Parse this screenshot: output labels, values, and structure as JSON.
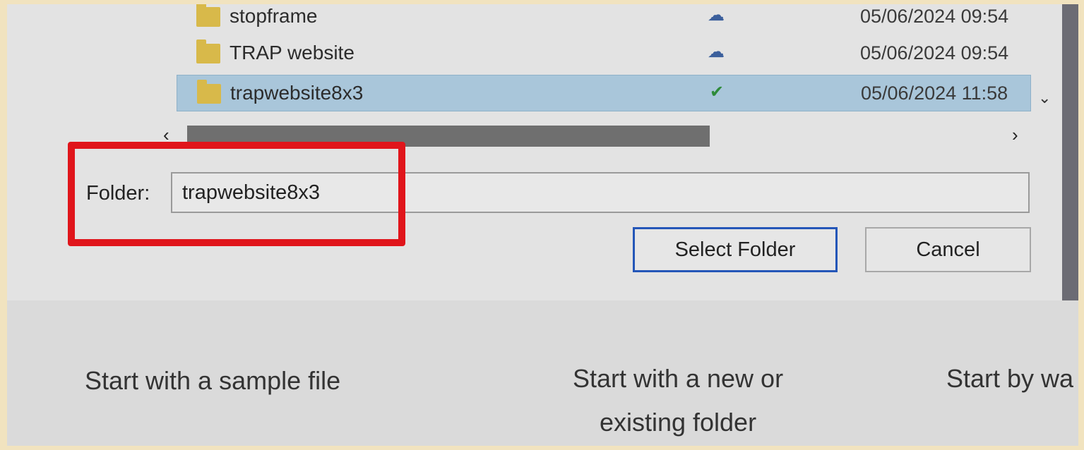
{
  "file_list": {
    "rows": [
      {
        "name": "stopframe",
        "status_icon": "cloud-icon",
        "date": "05/06/2024 09:54"
      },
      {
        "name": "TRAP website",
        "status_icon": "cloud-icon",
        "date": "05/06/2024 09:54"
      },
      {
        "name": "trapwebsite8x3",
        "status_icon": "check-circle-icon",
        "date": "05/06/2024 11:58"
      }
    ],
    "selected_index": 2
  },
  "scroll": {
    "left_arrow": "‹",
    "right_arrow": "›",
    "down_arrow": "⌄"
  },
  "folder_field": {
    "label": "Folder:",
    "value": "trapwebsite8x3"
  },
  "buttons": {
    "select_label": "Select Folder",
    "cancel_label": "Cancel"
  },
  "start_options": {
    "sample": "Start with a sample file",
    "folder_line1": "Start with a new or",
    "folder_line2": "existing folder",
    "web": "Start by wa"
  },
  "colors": {
    "highlight": "#e0151b",
    "selection": "#a9c6da",
    "primary_button_border": "#2456b8"
  }
}
